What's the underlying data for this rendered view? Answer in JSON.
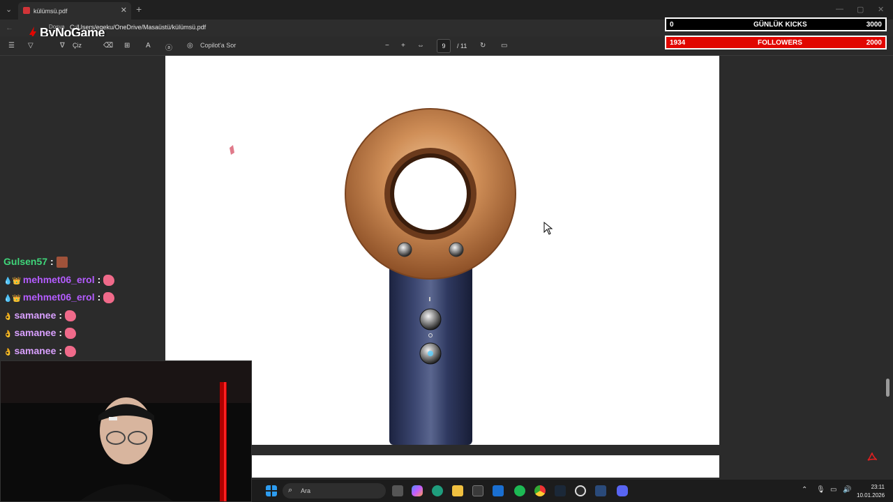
{
  "browser": {
    "tab_title": "külümsü.pdf",
    "new_tab": "+",
    "close": "✕",
    "address_prefix": "Dosya",
    "address": "C:/Users/egeku/OneDrive/Masaüstü/külümsü.pdf"
  },
  "pdf_toolbar": {
    "draw_label": "Çiz",
    "copilot_label": "Copilot'a Sor",
    "zoom_out": "−",
    "zoom_in": "+",
    "current_page": "9",
    "total_pages": "/ 11"
  },
  "overlay": {
    "logo": "ByNoGame",
    "kicks_count": "0",
    "kicks_label": "GÜNLÜK KICKS",
    "kicks_goal": "3000",
    "followers_count": "1934",
    "followers_label": "FOLLOWERS",
    "followers_goal": "2000"
  },
  "chat": [
    {
      "user": "Gulsen57",
      "color": "#3fd67a",
      "badges": ""
    },
    {
      "user": "mehmet06_erol",
      "color": "#b45cff",
      "badges": "💧👑"
    },
    {
      "user": "mehmet06_erol",
      "color": "#b45cff",
      "badges": "💧👑"
    },
    {
      "user": "samanee",
      "color": "#d9a0ff",
      "badges": "👌"
    },
    {
      "user": "samanee",
      "color": "#d9a0ff",
      "badges": "👌"
    },
    {
      "user": "samanee",
      "color": "#d9a0ff",
      "badges": "👌"
    }
  ],
  "chat_separator": ":",
  "taskbar": {
    "search_placeholder": "Ara",
    "time": "23:11",
    "date": "10.01.2026"
  },
  "colors": {
    "accent_red": "#e10600",
    "copper": "#c5804d",
    "navy": "#2b3556"
  }
}
